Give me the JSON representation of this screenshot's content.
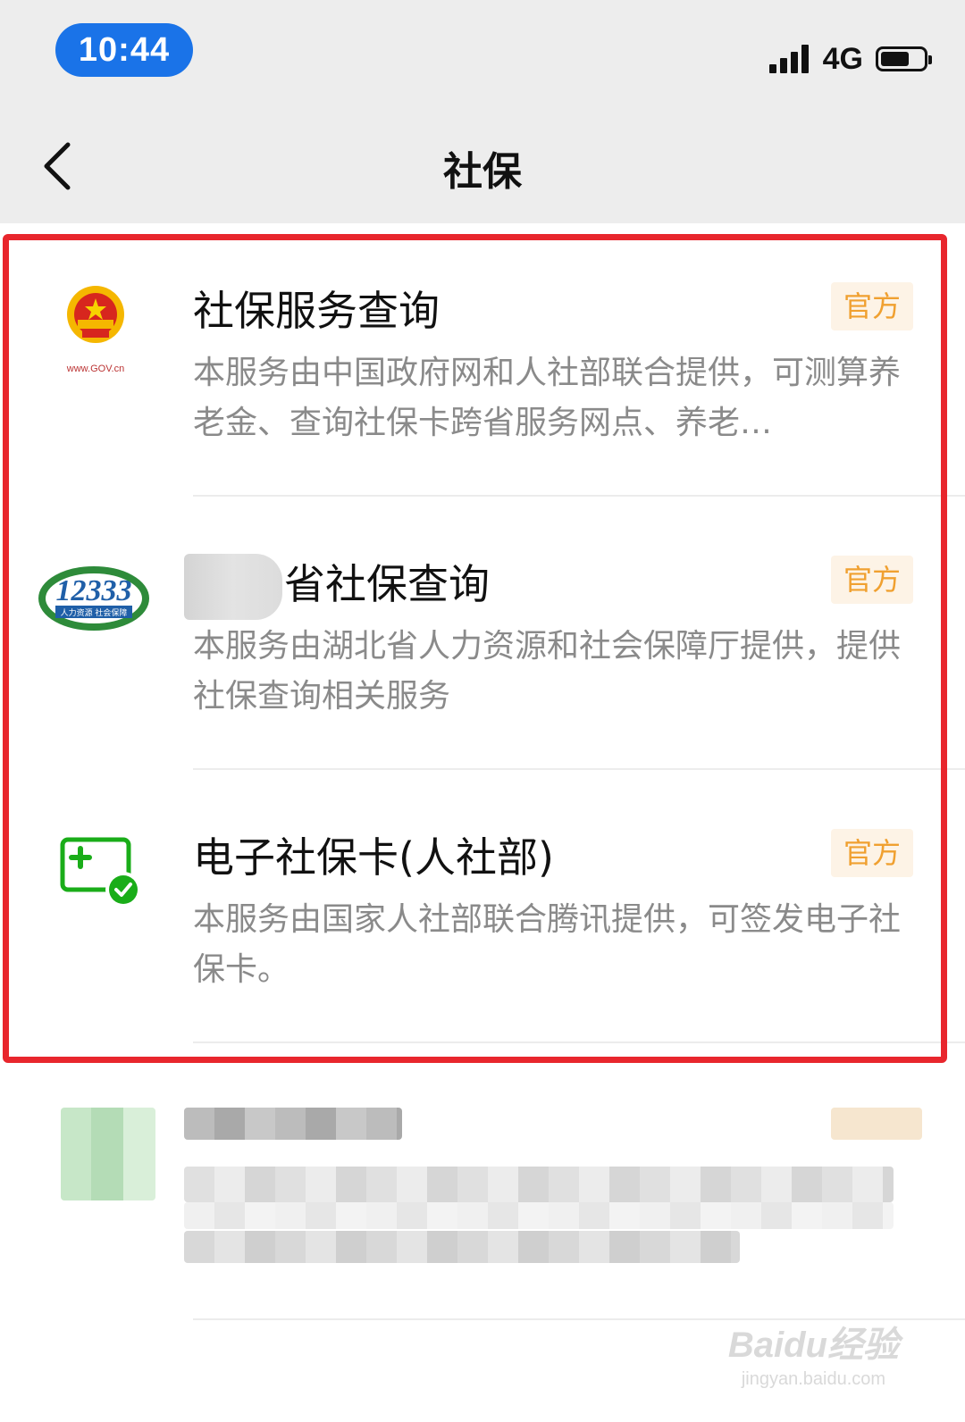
{
  "status_bar": {
    "time": "10:44",
    "network": "4G"
  },
  "nav": {
    "title": "社保"
  },
  "colors": {
    "highlight_border": "#e8262d",
    "badge_text": "#f0a030",
    "time_pill": "#1a73e8"
  },
  "items": [
    {
      "title": "社保服务查询",
      "badge": "官方",
      "description": "本服务由中国政府网和人社部联合提供，可测算养老金、查询社保卡跨省服务网点、养老…",
      "logo": "gov-emblem-icon",
      "logo_caption": "www.GOV.cn"
    },
    {
      "title": "省社保查询",
      "badge": "官方",
      "description": "本服务由湖北省人力资源和社会保障厅提供，提供社保查询相关服务",
      "logo": "12333-logo-icon",
      "logo_text": "12333",
      "logo_caption": "人力资源 社会保障"
    },
    {
      "title": "电子社保卡(人社部)",
      "badge": "官方",
      "description": "本服务由国家人社部联合腾讯提供，可签发电子社保卡。",
      "logo": "e-social-card-icon"
    }
  ],
  "watermark": {
    "main": "Baidu经验",
    "sub": "jingyan.baidu.com"
  }
}
